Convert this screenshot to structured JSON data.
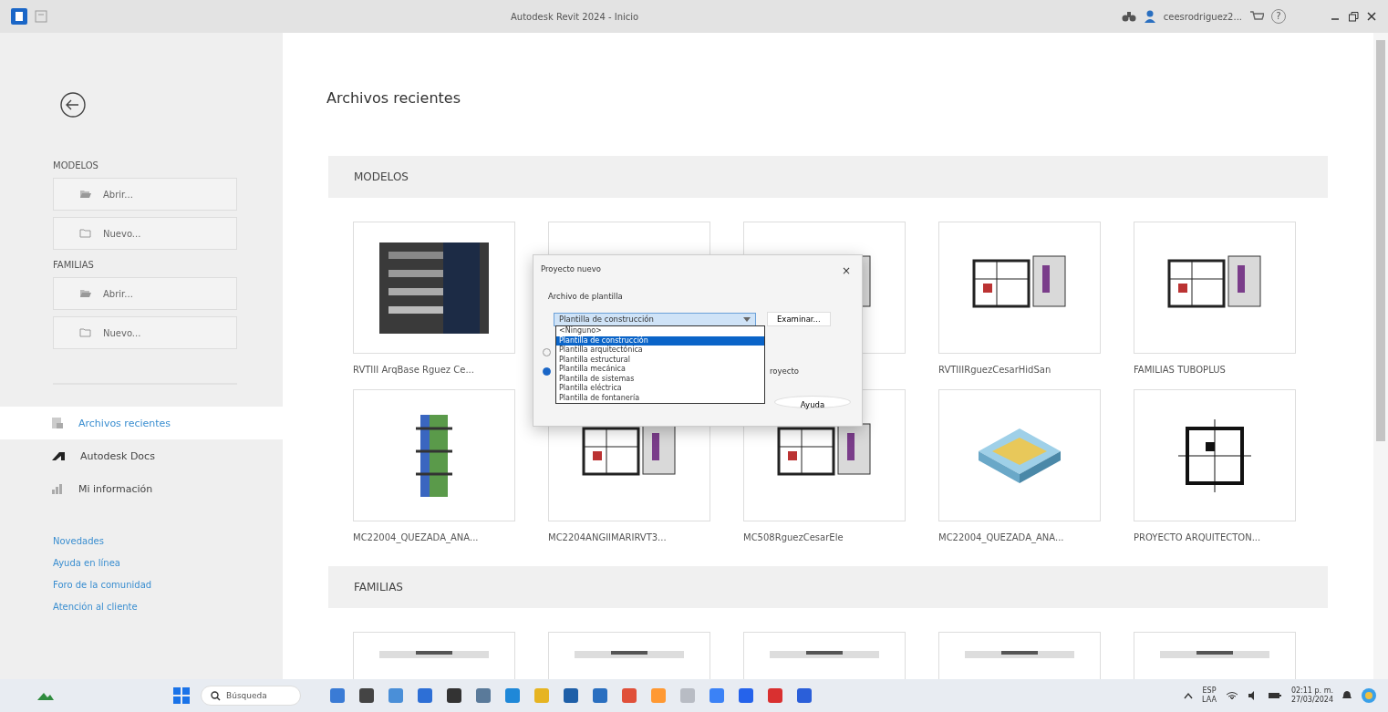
{
  "window": {
    "title": "Autodesk Revit 2024 - Inicio",
    "user": "ceesrodriguez2...",
    "help": "?"
  },
  "sidebar": {
    "sections": [
      {
        "title": "MODELOS",
        "buttons": [
          {
            "label": "Abrir...",
            "kind": "open"
          },
          {
            "label": "Nuevo...",
            "kind": "new"
          }
        ]
      },
      {
        "title": "FAMILIAS",
        "buttons": [
          {
            "label": "Abrir...",
            "kind": "open"
          },
          {
            "label": "Nuevo...",
            "kind": "new"
          }
        ]
      }
    ],
    "nav": [
      {
        "label": "Archivos recientes",
        "kind": "recent",
        "selected": true
      },
      {
        "label": "Autodesk Docs",
        "kind": "docs",
        "selected": false
      },
      {
        "label": "Mi información",
        "kind": "info",
        "selected": false
      }
    ],
    "links": [
      "Novedades",
      "Ayuda en línea",
      "Foro de la comunidad",
      "Atención al cliente"
    ]
  },
  "main": {
    "title": "Archivos recientes",
    "sections": [
      {
        "title": "MODELOS",
        "files": [
          {
            "name": "RVTIII ArqBase Rguez Ce...",
            "kind": "tower"
          },
          {
            "kind": "covered"
          },
          {
            "kind": "plan"
          },
          {
            "name": "RVTIIIRguezCesarHidSan",
            "kind": "plan"
          },
          {
            "name": "FAMILIAS TUBOPLUS",
            "kind": "plan"
          },
          {
            "name": "MC22004_QUEZADA_ANA...",
            "kind": "frame"
          },
          {
            "name": "MC2204ANGIIMARIRVT3...",
            "kind": "plan"
          },
          {
            "name": "MC508RguezCesarEle",
            "kind": "plan"
          },
          {
            "name": "MC22004_QUEZADA_ANA...",
            "kind": "iso"
          },
          {
            "name": "PROYECTO ARQUITECTON...",
            "kind": "grid"
          }
        ]
      },
      {
        "title": "FAMILIAS",
        "files": [
          {
            "kind": "blank"
          },
          {
            "kind": "blank"
          },
          {
            "kind": "blank"
          },
          {
            "kind": "blank"
          },
          {
            "kind": "blank"
          }
        ]
      }
    ]
  },
  "dialog": {
    "title": "Proyecto nuevo",
    "close": "×",
    "template_label": "Archivo de plantilla",
    "template_value": "Plantilla de construcción",
    "browse": "Examinar...",
    "options": [
      {
        "label": "<Ninguno>",
        "selected": false
      },
      {
        "label": "Plantilla de construcción",
        "selected": true
      },
      {
        "label": "Plantilla arquitectónica",
        "selected": false
      },
      {
        "label": "Plantilla estructural",
        "selected": false
      },
      {
        "label": "Plantilla mecánica",
        "selected": false
      },
      {
        "label": "Plantilla de sistemas",
        "selected": false
      },
      {
        "label": "Plantilla eléctrica",
        "selected": false
      },
      {
        "label": "Plantilla de fontanería",
        "selected": false
      }
    ],
    "radios": [
      {
        "selected": false
      },
      {
        "selected": true,
        "label_tail": "royecto"
      }
    ],
    "help": "Ayuda"
  },
  "taskbar": {
    "search": "Búsqueda",
    "language": "ESP",
    "layout": "LAA",
    "time": "02:11 p. m.",
    "date": "27/03/2024"
  }
}
